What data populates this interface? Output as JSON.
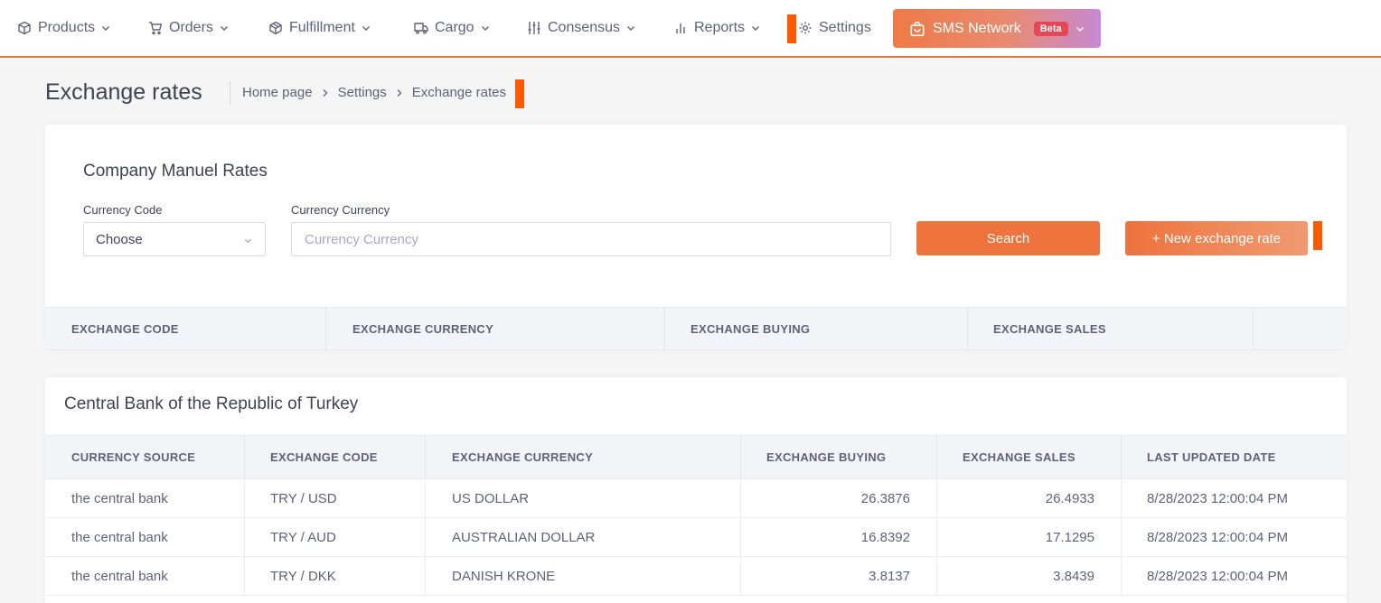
{
  "nav": {
    "items": [
      {
        "label": "Products",
        "icon": "box-icon"
      },
      {
        "label": "Orders",
        "icon": "cart-icon"
      },
      {
        "label": "Fulfillment",
        "icon": "cube-icon"
      },
      {
        "label": "Cargo",
        "icon": "truck-icon"
      },
      {
        "label": "Consensus",
        "icon": "sliders-icon"
      },
      {
        "label": "Reports",
        "icon": "bar-chart-icon"
      },
      {
        "label": "Settings",
        "icon": "gear-icon"
      }
    ],
    "sms": {
      "label": "SMS Network",
      "badge": "Beta"
    }
  },
  "header": {
    "title": "Exchange rates",
    "breadcrumb": [
      "Home page",
      "Settings",
      "Exchange rates"
    ]
  },
  "manual": {
    "title": "Company Manuel Rates",
    "code_label": "Currency Code",
    "code_value": "Choose",
    "currency_label": "Currency Currency",
    "currency_placeholder": "Currency Currency",
    "search_label": "Search",
    "new_label": "+ New exchange rate",
    "columns": [
      "EXCHANGE CODE",
      "EXCHANGE CURRENCY",
      "EXCHANGE BUYING",
      "EXCHANGE SALES"
    ]
  },
  "central": {
    "title": "Central Bank of the Republic of Turkey",
    "columns": [
      "CURRENCY SOURCE",
      "EXCHANGE CODE",
      "EXCHANGE CURRENCY",
      "EXCHANGE BUYING",
      "EXCHANGE SALES",
      "LAST UPDATED DATE"
    ],
    "rows": [
      [
        "the central bank",
        "TRY / USD",
        "US DOLLAR",
        "26.3876",
        "26.4933",
        "8/28/2023 12:00:04 PM"
      ],
      [
        "the central bank",
        "TRY / AUD",
        "AUSTRALIAN DOLLAR",
        "16.8392",
        "17.1295",
        "8/28/2023 12:00:04 PM"
      ],
      [
        "the central bank",
        "TRY / DKK",
        "DANISH KRONE",
        "3.8137",
        "3.8439",
        "8/28/2023 12:00:04 PM"
      ]
    ]
  },
  "colors": {
    "accent": "#ee733c",
    "marker": "#ff5a00",
    "beta": "#e54756"
  }
}
